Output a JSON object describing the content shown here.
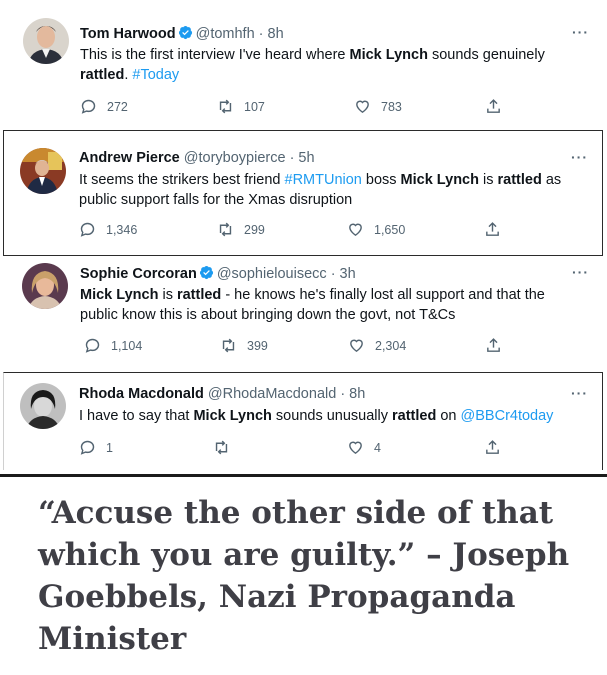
{
  "tweets": [
    {
      "name": "Tom Harwood",
      "verified": true,
      "handle": "@tomhfh · 8h",
      "text_segments": [
        {
          "t": "This is the first interview I've heard where ",
          "style": "normal"
        },
        {
          "t": "Mick Lynch",
          "style": "bold"
        },
        {
          "t": " sounds genuinely ",
          "style": "normal"
        },
        {
          "t": "rattled",
          "style": "bold"
        },
        {
          "t": ". ",
          "style": "normal"
        },
        {
          "t": "#Today",
          "style": "link"
        }
      ],
      "replies": "272",
      "retweets": "107",
      "likes": "783"
    },
    {
      "name": "Andrew Pierce",
      "verified": false,
      "handle": "@toryboypierce · 5h",
      "text_segments": [
        {
          "t": "It seems the strikers best friend ",
          "style": "normal"
        },
        {
          "t": "#RMTUnion",
          "style": "link"
        },
        {
          "t": " boss ",
          "style": "normal"
        },
        {
          "t": "Mick Lynch",
          "style": "bold"
        },
        {
          "t": " is ",
          "style": "normal"
        },
        {
          "t": "rattled",
          "style": "bold"
        },
        {
          "t": " as public support falls for the Xmas disruption",
          "style": "normal"
        }
      ],
      "replies": "1,346",
      "retweets": "299",
      "likes": "1,650"
    },
    {
      "name": "Sophie Corcoran",
      "verified": true,
      "handle": "@sophielouisecc · 3h",
      "text_segments": [
        {
          "t": "Mick Lynch",
          "style": "bold"
        },
        {
          "t": " is ",
          "style": "normal"
        },
        {
          "t": "rattled",
          "style": "bold"
        },
        {
          "t": " - he knows he's finally lost all support and that the public know this is about bringing down the govt, not T&Cs",
          "style": "normal"
        }
      ],
      "replies": "1,104",
      "retweets": "399",
      "likes": "2,304"
    },
    {
      "name": "Rhoda Macdonald",
      "verified": false,
      "handle": "@RhodaMacdonald · 8h",
      "text_segments": [
        {
          "t": "I have to say that ",
          "style": "normal"
        },
        {
          "t": "Mick Lynch",
          "style": "bold"
        },
        {
          "t": " sounds unusually ",
          "style": "normal"
        },
        {
          "t": "rattled",
          "style": "bold"
        },
        {
          "t": " on ",
          "style": "normal"
        },
        {
          "t": "@BBCr4today",
          "style": "link"
        }
      ],
      "replies": "1",
      "retweets": "",
      "likes": "4"
    }
  ],
  "more_label": "···",
  "quote": "“Accuse the other side of that which you are guilty.” – Joseph Goebbels, Nazi Propaganda Minister",
  "colors": {
    "link": "#1d9bf0",
    "muted": "#536471",
    "verified": "#1d9bf0",
    "quote": "#3f3f46"
  }
}
